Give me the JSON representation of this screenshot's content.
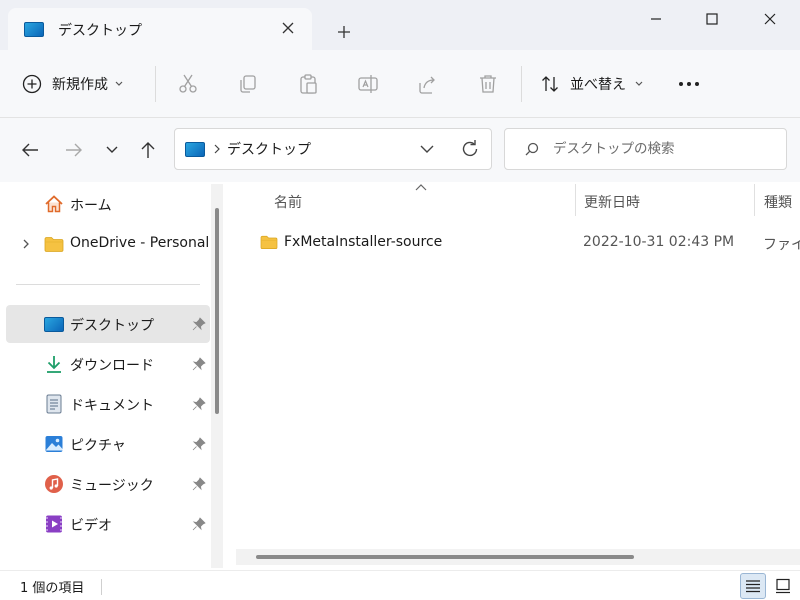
{
  "window": {
    "tab_title": "デスクトップ",
    "new_tab": "+"
  },
  "toolbar": {
    "new_label": "新規作成",
    "sort_label": "並べ替え",
    "more": "•••"
  },
  "address": {
    "crumb": "デスクトップ",
    "search_placeholder": "デスクトップの検索"
  },
  "sidebar": {
    "items": [
      {
        "label": "ホーム",
        "icon": "home-icon",
        "pinned": false
      },
      {
        "label": "OneDrive - Personal",
        "icon": "folder-icon",
        "pinned": false
      },
      {
        "label": "デスクトップ",
        "icon": "desktop-icon",
        "pinned": true,
        "selected": true
      },
      {
        "label": "ダウンロード",
        "icon": "download-icon",
        "pinned": true
      },
      {
        "label": "ドキュメント",
        "icon": "document-icon",
        "pinned": true
      },
      {
        "label": "ピクチャ",
        "icon": "pictures-icon",
        "pinned": true
      },
      {
        "label": "ミュージック",
        "icon": "music-icon",
        "pinned": true
      },
      {
        "label": "ビデオ",
        "icon": "video-icon",
        "pinned": true
      }
    ]
  },
  "content": {
    "columns": {
      "name": "名前",
      "date": "更新日時",
      "type": "種類"
    },
    "rows": [
      {
        "name": "FxMetaInstaller-source",
        "date": "2022-10-31 02:43 PM",
        "type": "ファイル"
      }
    ]
  },
  "status": {
    "count": "1 個の項目"
  },
  "colors": {
    "accent": "#005fb8",
    "folder": "#f5c242",
    "selected_bg": "#e6e6e6"
  }
}
